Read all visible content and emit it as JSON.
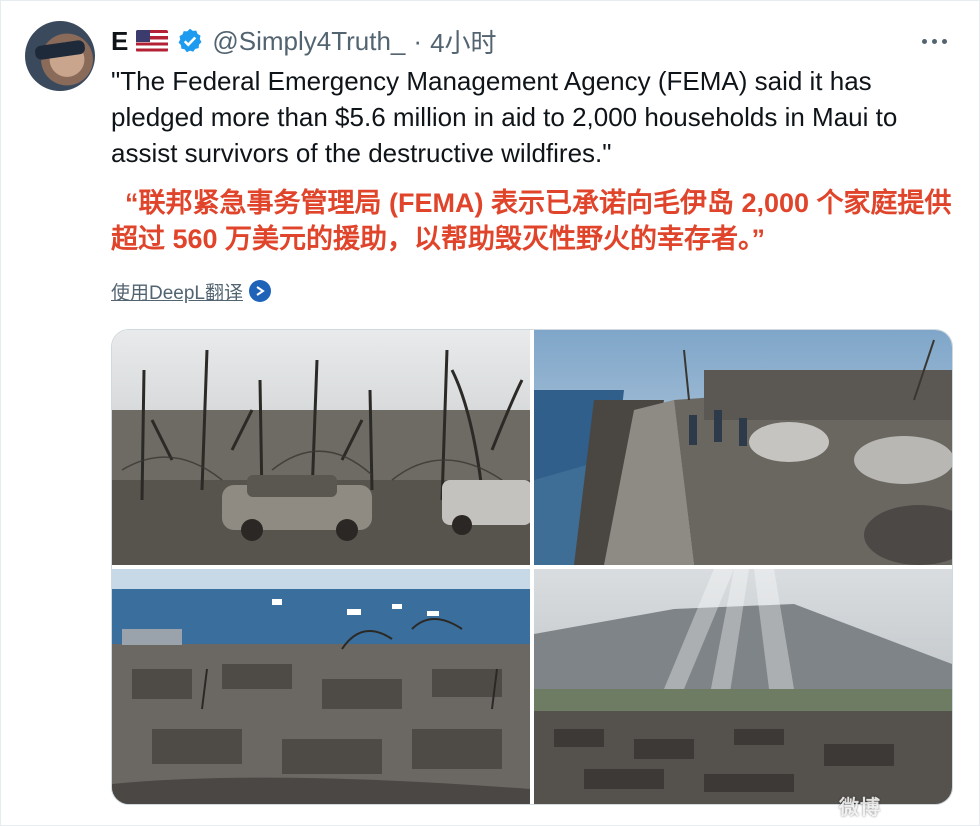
{
  "tweet": {
    "author_name": "E",
    "handle": "@Simply4Truth_",
    "separator": "·",
    "time": "4小时",
    "text": "\"The Federal Emergency Management Agency (FEMA) said it has pledged more than $5.6 million in aid to 2,000 households in Maui to assist survivors of the destructive wildfires.\"",
    "translation": "“联邦紧急事务管理局 (FEMA) 表示已承诺向毛伊岛 2,000 个家庭提供超过 560 万美元的援助，以帮助毁灭性野火的幸存者。”",
    "translate_link": "使用DeepL翻译"
  },
  "icons": {
    "flag": "us-flag-icon",
    "verified": "verified-badge-icon",
    "more": "more-options-icon",
    "deepl": "deepl-icon"
  },
  "media": {
    "photos": [
      {
        "description": "burned-town-cars"
      },
      {
        "description": "seawall-street-burned-cars"
      },
      {
        "description": "aerial-burned-town-harbor"
      },
      {
        "description": "mountain-sunrays-burned-town"
      }
    ]
  },
  "watermark": "微博",
  "colors": {
    "translation_red": "#e0442b",
    "verified_blue": "#1d9bf0",
    "text_dark": "#0f1419",
    "text_gray": "#536471"
  }
}
